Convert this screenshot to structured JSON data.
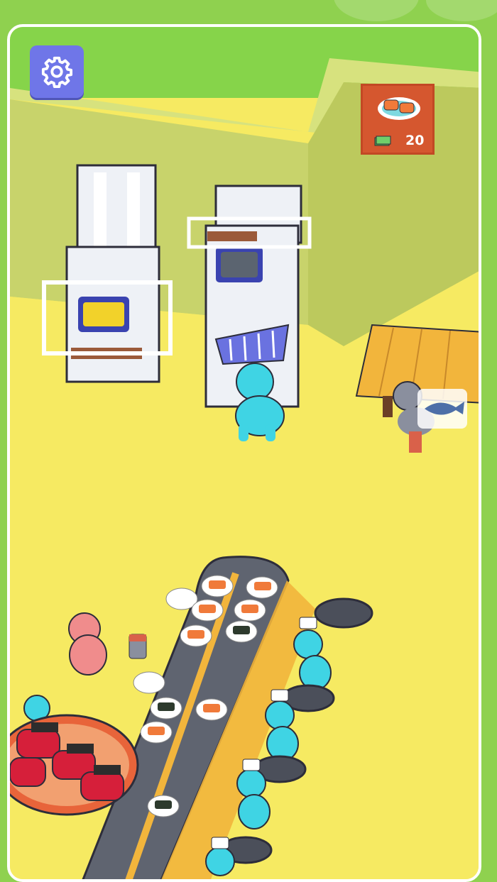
{
  "hud": {
    "settings_icon": "gear-icon"
  },
  "menu_sign": {
    "item_icon": "salmon-sushi-plate-icon",
    "currency_icon": "cash-icon",
    "price": "20"
  },
  "colors": {
    "outer_bg": "#8fd14f",
    "floor": "#f6ea62",
    "wall": "#c8d36b",
    "settings_button": "#6f76e8",
    "price_card": "#d5572f",
    "staff": "#3fd4e4",
    "customer": "#f08c8c",
    "conveyor": "#5f6470"
  }
}
